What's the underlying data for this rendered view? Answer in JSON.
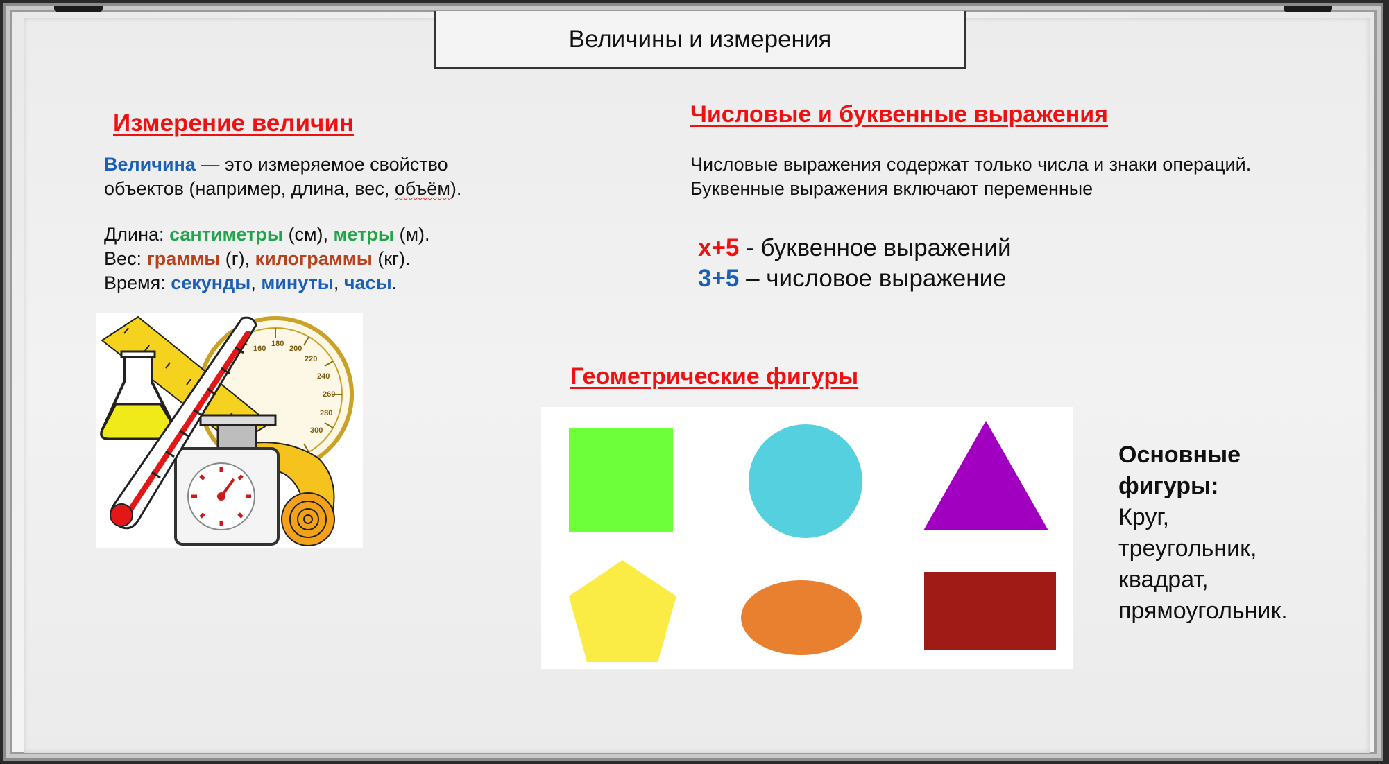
{
  "title": "Величины и измерения",
  "left": {
    "heading": "Измерение величин",
    "definition": {
      "term": "Величина",
      "rest_line1": " — это измеряемое свойство",
      "line2_a": "объектов (например, длина, вес, ",
      "line2_word": "объём",
      "line2_b": ")."
    },
    "units": {
      "length_label": "Длина: ",
      "length_u1": "сантиметры",
      "length_a1": " (см), ",
      "length_u2": "метры",
      "length_a2": " (м).",
      "weight_label": "Вес: ",
      "weight_u1": "граммы",
      "weight_a1": " (г), ",
      "weight_u2": "килограммы",
      "weight_a2": " (кг).",
      "time_label": "Время: ",
      "time_u1": "секунды",
      "time_sep1": ", ",
      "time_u2": "минуты",
      "time_sep2": ", ",
      "time_u3": "часы",
      "time_end": "."
    },
    "illustration": {
      "gauge_ticks": [
        "160",
        "180",
        "200",
        "220",
        "240",
        "260",
        "280",
        "300"
      ]
    }
  },
  "right": {
    "heading": "Числовые и буквенные выражения",
    "desc_line1": "Числовые выражения содержат только числа и знаки операций.",
    "desc_line2": "Буквенные выражения включают переменные",
    "example1_expr": "x+5",
    "example1_text": " - буквенное выражений",
    "example2_expr": "3+5",
    "example2_text": " – числовое выражение"
  },
  "geometry": {
    "heading": "Геометрические фигуры",
    "basic_title_1": "Основные",
    "basic_title_2": "фигуры:",
    "basic_items": [
      "Круг,",
      "треугольник,",
      "квадрат,",
      "прямоугольник."
    ],
    "shape_colors": {
      "square": "#6dff3a",
      "circle": "#55d0de",
      "triangle": "#a100c1",
      "pentagon": "#fbeb45",
      "ellipse": "#e98030",
      "rectangle": "#a01a16"
    }
  },
  "colors": {
    "heading_red": "#ee1111",
    "term_blue": "#1b5fb7",
    "unit_green": "#22a44a",
    "unit_brown": "#b8421b"
  }
}
